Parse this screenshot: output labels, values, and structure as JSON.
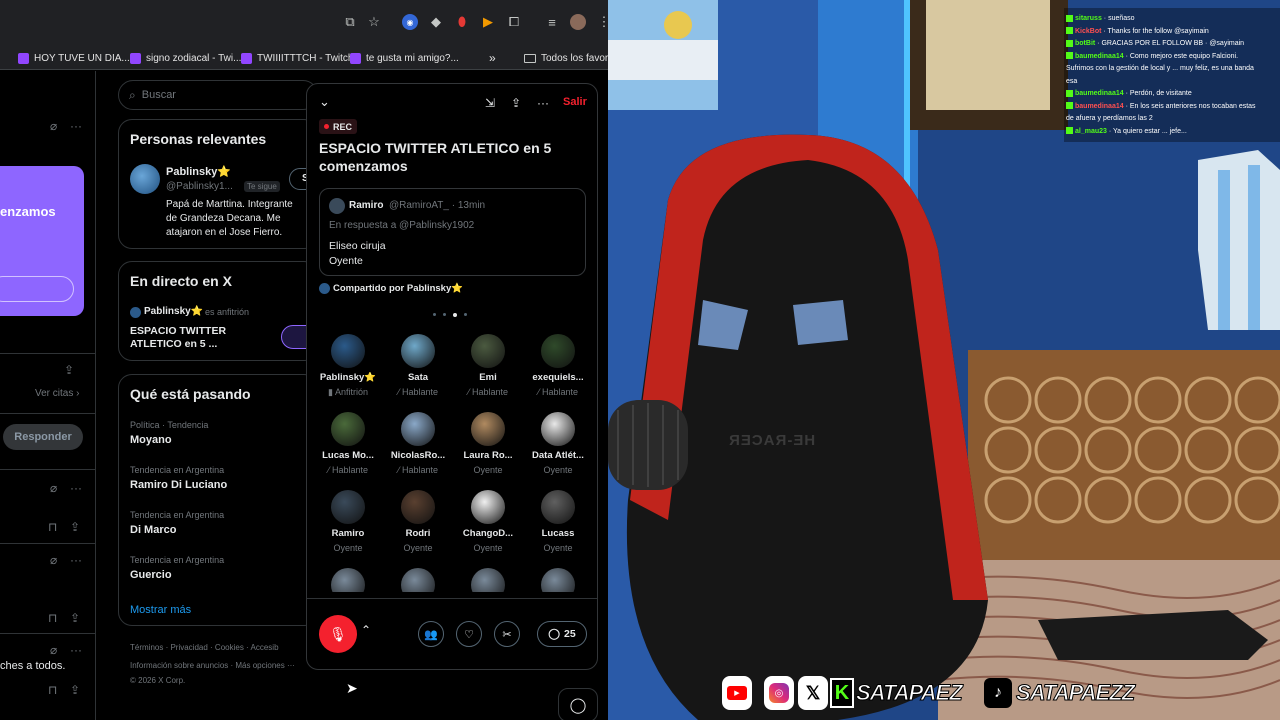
{
  "colors": {
    "twitter_red": "#f4212e",
    "rec_red": "#f4212e",
    "twitch_purple": "#9146ff",
    "kick_green": "#53fc18",
    "cta_purple": "#8e66ff"
  },
  "bookmarks": [
    {
      "label": "HOY TUVE UN DIA...",
      "icon": "twitch-icon"
    },
    {
      "label": "signo zodiacal - Twi...",
      "icon": "twitch-icon"
    },
    {
      "label": "TWIIIITTTCH - Twitch",
      "icon": "twitch-icon"
    },
    {
      "label": "te gusta mi amigo?...",
      "icon": "twitch-icon"
    }
  ],
  "bookmarks_more": "»",
  "all_bookmarks": "Todos los favoritos",
  "left": {
    "promo_text": "enzamos",
    "citas": "Ver citas",
    "responder": "Responder",
    "snippet": "ches a todos."
  },
  "search": {
    "placeholder": "Buscar"
  },
  "relevantes": {
    "title": "Personas relevantes",
    "name": "Pablinsky⭐",
    "handle": "@Pablinsky1...",
    "follows_you": "Te sigue",
    "follow_btn": "Si",
    "bio": "Papá de Marttina. Integrante de Grandeza Decana. Me atajaron en el Jose Fierro."
  },
  "directo": {
    "title": "En directo en X",
    "host": "Pablinsky⭐",
    "host_suffix": "es anfitrión",
    "space_title": "ESPACIO TWITTER ATLETICO en 5 ..."
  },
  "trends": {
    "title": "Qué está pasando",
    "items": [
      {
        "context": "Política · Tendencia",
        "name": "Moyano"
      },
      {
        "context": "Tendencia en Argentina",
        "name": "Ramiro Di Luciano"
      },
      {
        "context": "Tendencia en Argentina",
        "name": "Di Marco"
      },
      {
        "context": "Tendencia en Argentina",
        "name": "Guercio"
      }
    ],
    "more": "Mostrar más"
  },
  "footer": {
    "links": [
      "Términos",
      "Privacidad",
      "Cookies",
      "Accesib"
    ],
    "line2": "Información sobre anuncios · Más opciones ···",
    "copyright": "© 2026 X Corp."
  },
  "space": {
    "leave": "Salir",
    "rec": "REC",
    "title": "ESPACIO TWITTER ATLETICO en 5 comenzamos",
    "tweet": {
      "name": "Ramiro",
      "handle": "@RamiroAT_ · 13min",
      "reply_to": "En respuesta a @Pablinsky1902",
      "body_line1": "Eliseo ciruja",
      "body_line2": "Oyente"
    },
    "shared_by": "Compartido por Pablinsky⭐",
    "participants": [
      {
        "name": "Pablinsky⭐",
        "role": "Anfitrión",
        "color": "#2b5a8a"
      },
      {
        "name": "Sata",
        "role": "Hablante",
        "color": "#6fa8c9"
      },
      {
        "name": "Emi",
        "role": "Hablante",
        "color": "#4b5a40"
      },
      {
        "name": "exequiels...",
        "role": "Hablante",
        "color": "#2f4a2a"
      },
      {
        "name": "Lucas Mo...",
        "role": "Hablante",
        "color": "#4a6a3a"
      },
      {
        "name": "NicolasRo...",
        "role": "Hablante",
        "color": "#8aa8c8"
      },
      {
        "name": "Laura Ro...",
        "role": "Oyente",
        "color": "#b08a60"
      },
      {
        "name": "Data Atlét...",
        "role": "Oyente",
        "color": "#e8e8e8"
      },
      {
        "name": "Ramiro",
        "role": "Oyente",
        "color": "#3a4a5a"
      },
      {
        "name": "Rodri",
        "role": "Oyente",
        "color": "#5a4030"
      },
      {
        "name": "ChangoD...",
        "role": "Oyente",
        "color": "#f0f0f0"
      },
      {
        "name": "Lucass",
        "role": "Oyente",
        "color": "#606060"
      }
    ],
    "comments_count": "25"
  },
  "stream": {
    "chat": [
      {
        "user": "sitaruss",
        "msg": "· sueñaso"
      },
      {
        "user": "KickBot",
        "msg": "· Thanks for the follow @sayimain"
      },
      {
        "user": "botBit",
        "msg": "· GRACIAS POR EL FOLLOW BB · @sayimain"
      },
      {
        "user": "baumedinaa14",
        "msg": "· Como mejoro este equipo Falcioni."
      },
      {
        "user": "",
        "msg": "Sufrimos con la gestión de local y ... muy feliz, es una banda"
      },
      {
        "user": "",
        "msg": "esa"
      },
      {
        "user": "baumedinaa14",
        "msg": "· Perdón, de visitante"
      },
      {
        "user": "baumedinaa14",
        "msg": "· En los seis anteriores nos tocaban estas"
      },
      {
        "user": "",
        "msg": "de afuera y perdíamos las 2"
      },
      {
        "user": "al_mau23",
        "msg": "· Ya quiero estar ... jefe..."
      }
    ],
    "chair_brand": "HE-RACER",
    "handle_kick": "SATAPAEZ",
    "handle_tiktok": "SATAPAEZZ"
  }
}
